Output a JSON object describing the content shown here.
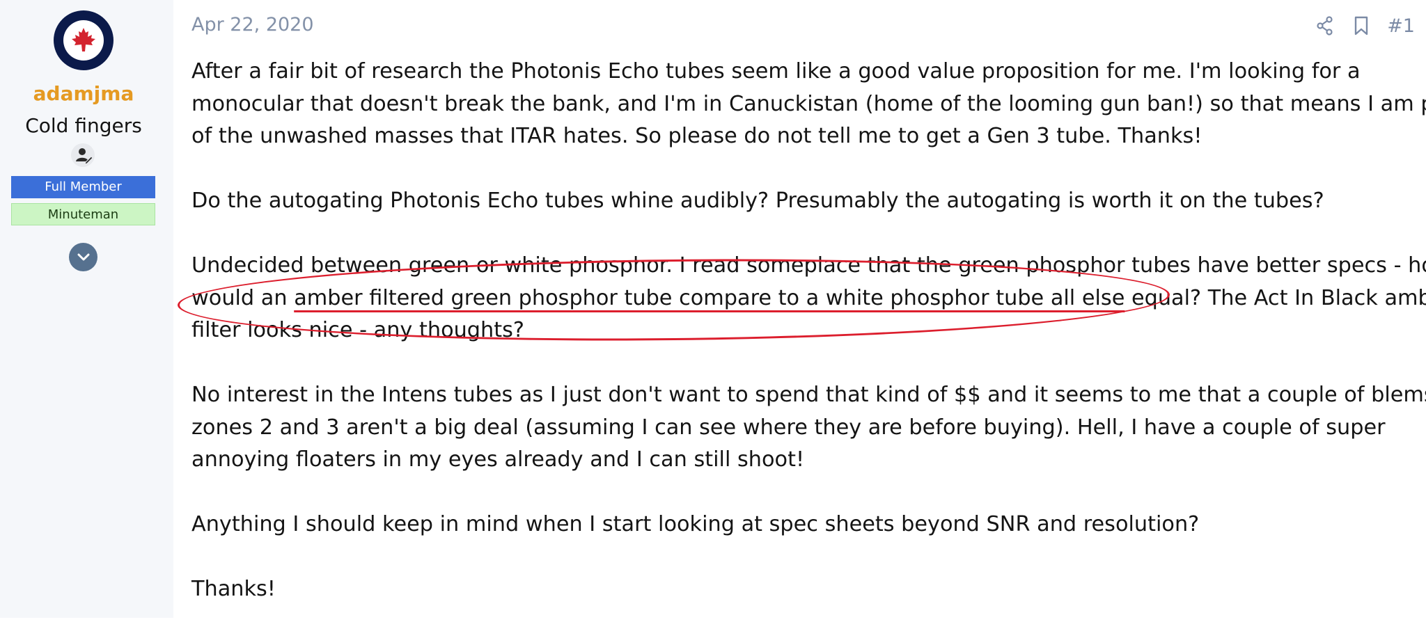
{
  "author": {
    "username": "adamjma",
    "title": "Cold fingers",
    "badges": [
      "Full Member",
      "Minuteman"
    ],
    "colors": {
      "username": "#e59a22",
      "badge_full_member": "#3b6fd9",
      "badge_minuteman": "#ccf5c4"
    }
  },
  "post": {
    "date": "Apr 22, 2020",
    "number": "#1",
    "paragraphs": [
      {
        "lines": [
          "After a fair bit of research the Photonis Echo tubes seem like a good value proposition for me. I'm looking for a",
          "monocular that doesn't break the bank, and I'm in Canuckistan (home of the looming gun ban!) so that means I am part",
          "of the unwashed masses that ITAR hates. So please do not tell me to get a Gen 3 tube. Thanks!"
        ]
      },
      {
        "lines": [
          "Do the autogating Photonis Echo tubes whine audibly? Presumably the autogating is worth it on the tubes?"
        ]
      },
      {
        "line1": "Undecided between green or white phosphor. I read someplace that the green phosphor tubes have better specs - how",
        "line2_before": "would an ",
        "line2_underlined": "amber filtered green phosphor tube compare to a white phosphor tube all else",
        "line2_after": " equal? The Act In Black amber",
        "line3": "filter looks nice - any thoughts?"
      },
      {
        "lines": [
          "No interest in the Intens tubes as I just don't want to spend that kind of $$ and it seems to me that a couple of blems in",
          "zones 2 and 3 aren't a big deal (assuming I can see where they are before buying). Hell, I have a couple of super",
          "annoying floaters in my eyes already and I can still shoot!"
        ]
      },
      {
        "lines": [
          "Anything I should keep in mind when I start looking at spec sheets beyond SNR and resolution?"
        ]
      },
      {
        "lines": [
          "Thanks!"
        ]
      }
    ]
  },
  "icons": {
    "avatar": "canada-roundel-icon",
    "user_status": "person-edit-icon",
    "expand": "chevron-down-icon",
    "share": "share-icon",
    "bookmark": "bookmark-icon"
  },
  "annotation_color": "#dc1e2d"
}
